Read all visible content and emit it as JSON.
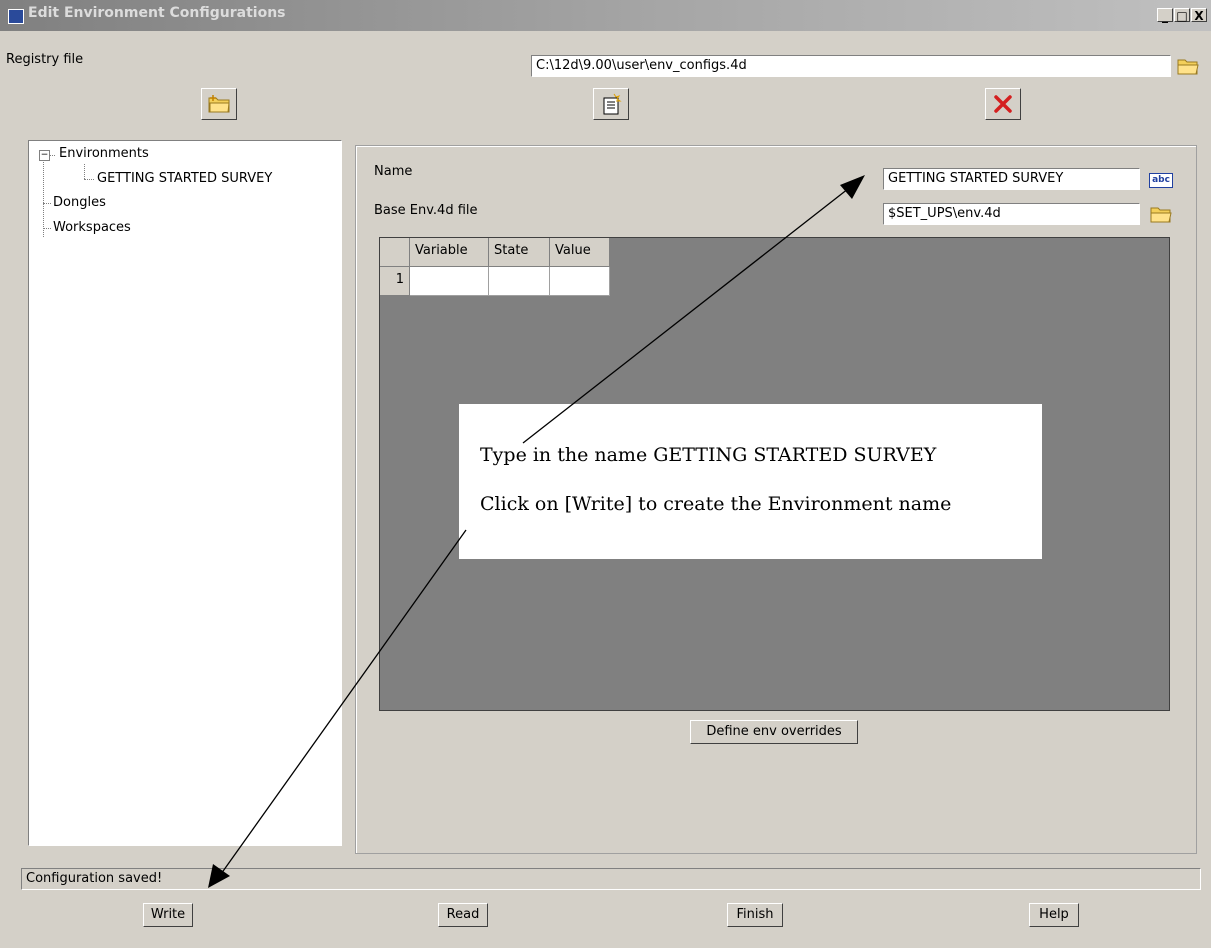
{
  "window": {
    "title": "Edit Environment Configurations",
    "controls": [
      "_",
      "□",
      "X"
    ]
  },
  "registry": {
    "label": "Registry file",
    "value": "C:\\12d\\9.00\\user\\env_configs.4d"
  },
  "tree": {
    "root": "Environments",
    "child": "GETTING STARTED SURVEY",
    "items": [
      "Dongles",
      "Workspaces"
    ]
  },
  "form": {
    "name_label": "Name",
    "name_value": "GETTING STARTED SURVEY",
    "base_label": "Base Env.4d file",
    "base_value": "$SET_UPS\\env.4d"
  },
  "grid": {
    "columns": [
      "Variable",
      "State",
      "Value"
    ],
    "rows": [
      [
        "1",
        "",
        "",
        ""
      ]
    ]
  },
  "define_button": "Define env overrides",
  "callout": {
    "line1": "Type in the name GETTING STARTED SURVEY",
    "line2": "Click on [Write] to create the Environment name"
  },
  "status": "Configuration saved!",
  "buttons": {
    "write": "Write",
    "read": "Read",
    "finish": "Finish",
    "help": "Help"
  },
  "icons": {
    "abc": "abc"
  },
  "colors": {
    "delete_red": "#d42020",
    "folder_yellow": "#f3cf5a",
    "grid_bg": "#808080"
  }
}
